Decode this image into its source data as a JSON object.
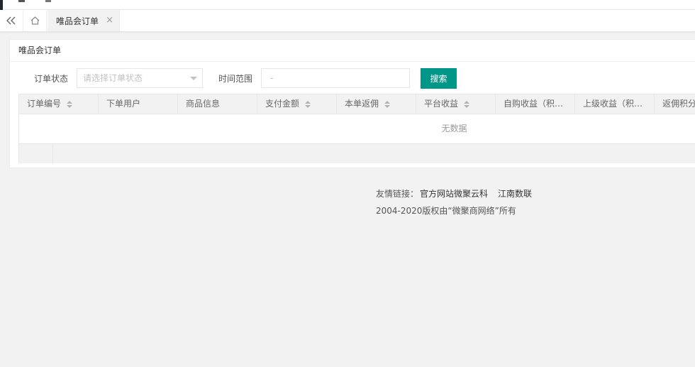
{
  "tabs": {
    "collapse_icon": "double-chevron-left-icon",
    "home_icon": "home-icon",
    "active_label": "唯品会订单",
    "close_icon": "close-icon"
  },
  "card": {
    "title": "唯品会订单"
  },
  "filters": {
    "status_label": "订单状态",
    "status_placeholder": "请选择订单状态",
    "range_label": "时间范围",
    "range_value": "-",
    "search_label": "搜索"
  },
  "table": {
    "columns": [
      {
        "label": "订单编号",
        "sortable": true
      },
      {
        "label": "下单用户",
        "sortable": false
      },
      {
        "label": "商品信息",
        "sortable": false
      },
      {
        "label": "支付金额",
        "sortable": true
      },
      {
        "label": "本单返佣",
        "sortable": true
      },
      {
        "label": "平台收益",
        "sortable": true
      },
      {
        "label": "自购收益（积…",
        "sortable": false
      },
      {
        "label": "上级收益（积…",
        "sortable": false
      },
      {
        "label": "返佣积分",
        "sortable": false
      }
    ],
    "empty_text": "无数据"
  },
  "footer": {
    "links_prefix": "友情链接：",
    "links": [
      "官方网站微聚云科",
      "江南数联"
    ],
    "copyright": "2004-2020版权由“微聚商网络”所有"
  },
  "colors": {
    "primary": "#009688",
    "background": "#f2f2f2"
  }
}
